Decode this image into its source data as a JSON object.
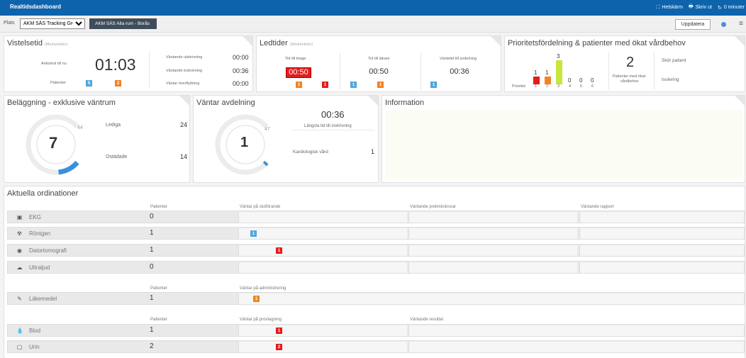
{
  "titlebar": {
    "title": "Realtidsdashboard",
    "fullscreen": "Helskärm",
    "print": "Skriv ut",
    "refresh": "0 minuter"
  },
  "toolbar": {
    "plats_label": "Plats",
    "plats_value": "AKM SÄS Tracking Group",
    "room_tab": "AKM SÄS Alla rum - Borås",
    "update_button": "Uppdatera"
  },
  "vistelsetid": {
    "title": "Vistelsetid",
    "subtitle": "(Mediantider)",
    "ankomst_label": "Ankomst till nu",
    "ankomst_time": "01:03",
    "patienter_label": "Patienter",
    "badge_blue": "5",
    "badge_orange": "2",
    "rows": [
      {
        "label": "Väntande utskrivning",
        "value": "00:00"
      },
      {
        "label": "Väntande inskrivning",
        "value": "00:36"
      },
      {
        "label": "Väntar överflyttning",
        "value": "00:00"
      }
    ]
  },
  "ledtider": {
    "title": "Ledtider",
    "subtitle": "(Mediantider)",
    "cols": [
      {
        "label": "Tid till triage",
        "value": "00:50",
        "badges": [
          "1",
          "1"
        ]
      },
      {
        "label": "Tid till läkare",
        "value": "00:50",
        "badges": [
          "1",
          "1"
        ]
      },
      {
        "label": "Väntetid till avdelning",
        "value": "00:36",
        "badges": [
          "1"
        ]
      }
    ]
  },
  "prioritet": {
    "title": "Prioritetsfördelning & patienter med ökat vårdbehov",
    "prio_label": "Prioritet",
    "bars": [
      {
        "prio": "1",
        "count": "1",
        "n": 1,
        "color": "#e31c1c"
      },
      {
        "prio": "2",
        "count": "1",
        "n": 1,
        "color": "#f48220"
      },
      {
        "prio": "3",
        "count": "3",
        "n": 3,
        "color": "#c6e63c"
      },
      {
        "prio": "4",
        "count": "0",
        "n": 0,
        "color": "#999"
      },
      {
        "prio": "5",
        "count": "0",
        "n": 0,
        "color": "#999"
      },
      {
        "prio": "6",
        "count": "0",
        "n": 0,
        "color": "#999"
      }
    ],
    "okat_count": "2",
    "okat_label_1": "Patienter med ökat",
    "okat_label_2": "vårdbehov",
    "skor_label": "Skör patient",
    "isolering_label": "Isolering"
  },
  "belaggning": {
    "title": "Beläggning - exklusive väntrum",
    "center": "7",
    "max": "44",
    "fill": 0.16,
    "lediga_label": "Lediga",
    "lediga_value": "24",
    "ostadade_label": "Ostädade",
    "ostadade_value": "14"
  },
  "avdelning": {
    "title": "Väntar avdelning",
    "center": "1",
    "max": "47",
    "fill": 0.02,
    "time": "00:36",
    "time_label": "Längsta tid till inskrivning",
    "kardio_label": "Kardiologisk vård",
    "kardio_value": "1"
  },
  "information": {
    "title": "Information"
  },
  "ordinationer": {
    "title": "Aktuella ordinationer",
    "group1_headers": [
      "Patienter",
      "Väntar på slutförande",
      "Väntande preliminärsvar",
      "Väntande rapport"
    ],
    "group2_headers": [
      "Patienter",
      "Väntar på administrering"
    ],
    "group3_headers": [
      "Patienter",
      "Väntar på provtagning",
      "Väntande resultat"
    ],
    "rows": [
      {
        "name": "EKG",
        "count": "0"
      },
      {
        "name": "Röntgen",
        "count": "1",
        "badge": "1"
      },
      {
        "name": "Datortomografi",
        "count": "1",
        "badge": "1"
      },
      {
        "name": "Ultraljud",
        "count": "0"
      },
      {
        "name": "Läkemedel",
        "count": "1",
        "badge": "1"
      },
      {
        "name": "Blod",
        "count": "1",
        "badge": "1"
      },
      {
        "name": "Urin",
        "count": "2",
        "badge": "2"
      }
    ]
  }
}
